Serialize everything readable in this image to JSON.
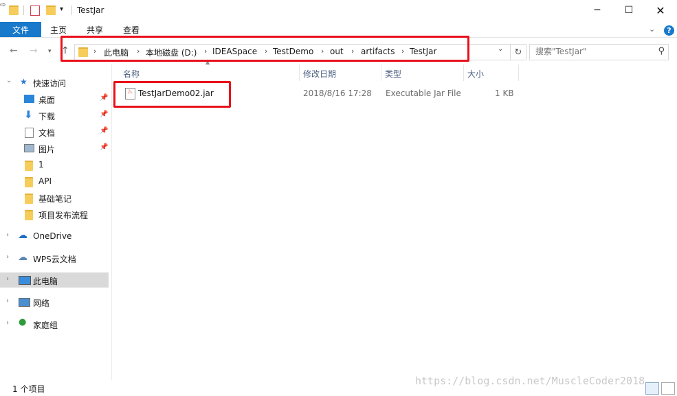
{
  "window": {
    "title": "TestJar"
  },
  "ribbon": {
    "tabs": [
      "文件",
      "主页",
      "共享",
      "查看"
    ]
  },
  "address": {
    "crumbs": [
      "此电脑",
      "本地磁盘 (D:)",
      "IDEASpace",
      "TestDemo",
      "out",
      "artifacts",
      "TestJar"
    ]
  },
  "search": {
    "placeholder": "搜索\"TestJar\""
  },
  "sidebar": {
    "quick_access": "快速访问",
    "items": [
      "桌面",
      "下载",
      "文档",
      "图片",
      "1",
      "API",
      "基础笔记",
      "项目发布流程"
    ],
    "sections": [
      "OneDrive",
      "WPS云文档",
      "此电脑",
      "网络",
      "家庭组"
    ]
  },
  "columns": {
    "name": "名称",
    "modified": "修改日期",
    "type": "类型",
    "size": "大小"
  },
  "files": [
    {
      "name": "TestJarDemo02.jar",
      "modified": "2018/8/16 17:28",
      "type": "Executable Jar File",
      "size": "1 KB"
    }
  ],
  "status": {
    "text": "1 个项目"
  },
  "watermark": "https://blog.csdn.net/MuscleCoder2018",
  "colors": {
    "accent": "#1979ca",
    "highlight": "#e8101a",
    "selected_bg": "#d9d9d9"
  }
}
